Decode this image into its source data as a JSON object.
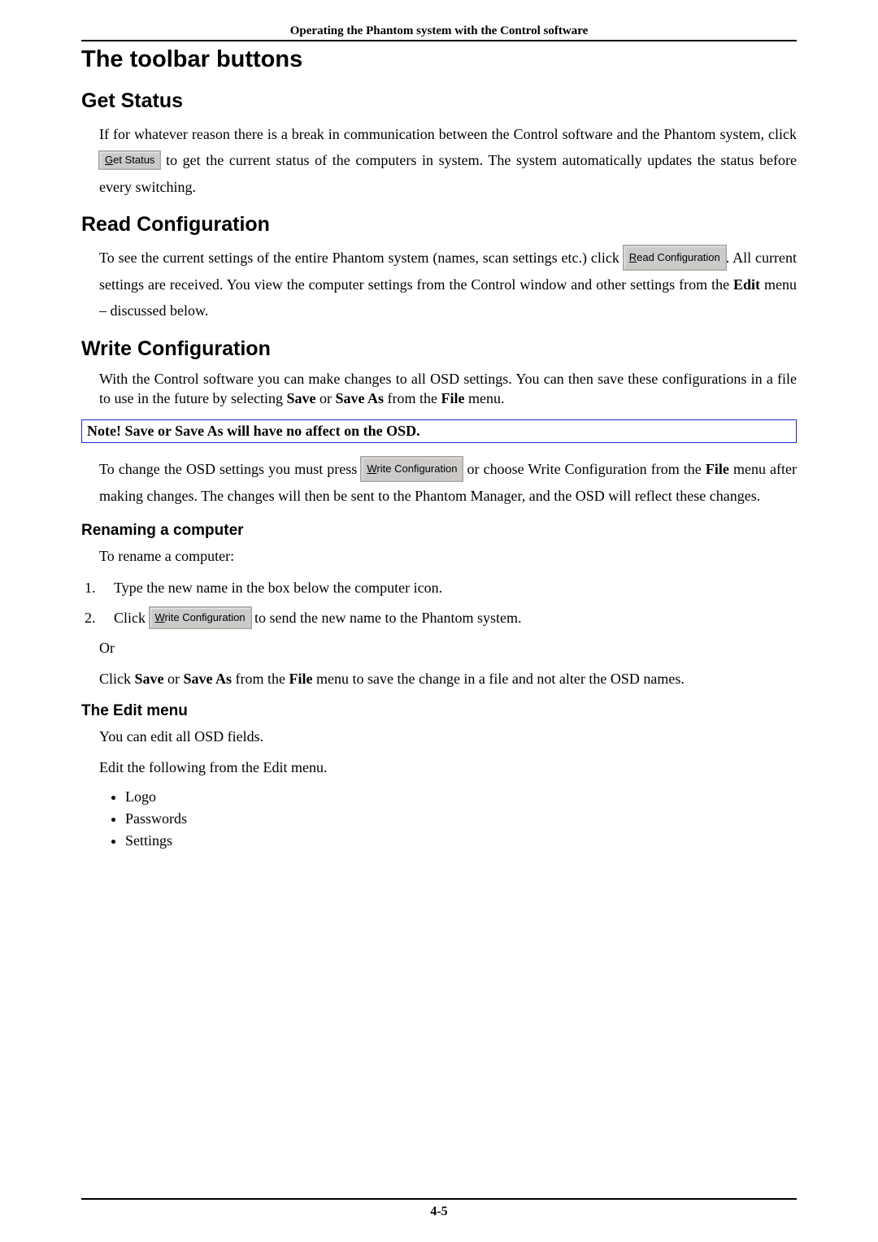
{
  "header": "Operating the Phantom system with the Control software",
  "h1": "The toolbar buttons",
  "sections": {
    "getStatus": {
      "title": "Get Status",
      "p1a": "If for whatever reason there is a break in communication between the Control software and the Phantom system, click ",
      "btn": "Get Status",
      "btnUL": "G",
      "p1b": " to get the current status of the computers in system. The system automatically updates the status before every switching."
    },
    "readConfig": {
      "title": "Read Configuration",
      "p1a": "To see the current settings of the entire Phantom system (names, scan settings etc.) click ",
      "btn": "Read Configuration",
      "btnUL": "R",
      "p1b": ". All current settings are received. You view the computer settings from the Control window and other settings from the ",
      "editWord": "Edit",
      "p1c": " menu – discussed below."
    },
    "writeConfig": {
      "title": "Write Configuration",
      "p1a": "With the Control software you can make changes to all OSD settings. You can then save these configurations in a file to use in the future by selecting ",
      "save": "Save",
      "or1": " or ",
      "saveAs": "Save As",
      "fromThe": " from the ",
      "fileWord": "File",
      "menuDot": " menu.",
      "note": "Note! Save or Save As will have no affect on the OSD.",
      "p2a": "To change the OSD settings you must press ",
      "btn": "Write Configuration",
      "btnUL": "W",
      "p2b": " or choose Write Configuration from the ",
      "p2c": " menu after making changes. The changes will then be sent to the Phantom Manager, and the OSD will reflect these changes."
    },
    "renaming": {
      "title": "Renaming a computer",
      "intro": "To rename a computer:",
      "li1": "Type the new name in the box below the computer icon.",
      "li2a": "Click ",
      "btn": "Write Configuration",
      "btnUL": "W",
      "li2b": " to send the new name to the Phantom system.",
      "or": "Or",
      "p3a": "Click ",
      "save": "Save",
      "or1": " or ",
      "saveAs": "Save As",
      "fromThe": " from the ",
      "fileWord": "File",
      "p3b": " menu to save the change in a file and not alter the OSD names."
    },
    "editMenu": {
      "title": "The Edit menu",
      "p1": "You can edit all OSD fields.",
      "p2": "Edit the following from the Edit menu.",
      "items": [
        "Logo",
        "Passwords",
        "Settings"
      ]
    }
  },
  "footer": "4-5"
}
